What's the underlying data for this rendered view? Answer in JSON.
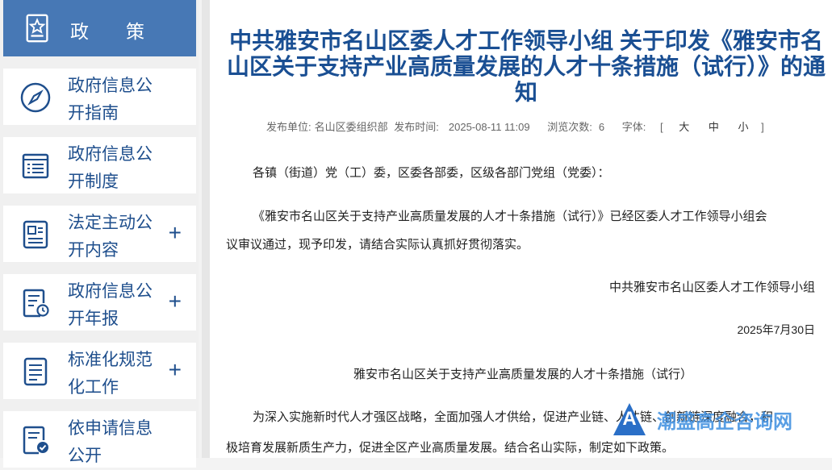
{
  "sidebar": {
    "header": {
      "label": "政策",
      "icon": "star-document-icon"
    },
    "items": [
      {
        "label": "政府信息公开指南",
        "icon": "compass-icon",
        "plus": ""
      },
      {
        "label": "政府信息公开制度",
        "icon": "list-document-icon",
        "plus": ""
      },
      {
        "label": "法定主动公开内容",
        "icon": "id-card-icon",
        "plus": "+"
      },
      {
        "label": "政府信息公开年报",
        "icon": "report-clock-icon",
        "plus": "+"
      },
      {
        "label": "标准化规范化工作",
        "icon": "document-lines-icon",
        "plus": "+"
      },
      {
        "label": "依申请信息公开",
        "icon": "document-check-icon",
        "plus": ""
      }
    ]
  },
  "article": {
    "title": "中共雅安市名山区委人才工作领导小组 关于印发《雅安市名山区关于支持产业高质量发展的人才十条措施（试行）》的通知",
    "meta": {
      "publisher_label": "发布单位:",
      "publisher": "名山区委组织部",
      "time_label": "发布时间:",
      "time": "2025-08-11 11:09",
      "views_label": "浏览次数:",
      "views": "6",
      "font_label": "字体:",
      "font_open": "[",
      "font_large": "大",
      "font_medium": "中",
      "font_small": "小",
      "font_close": "]"
    },
    "salutation": "各镇（街道）党（工）委，区委各部委，区级各部门党组（党委）：",
    "para1_line1": "《雅安市名山区关于支持产业高质量发展的人才十条措施（试行）》已经区委人才工作领导小组会",
    "para1_line2": "议审议通过，现予印发，请结合实际认真抓好贯彻落实。",
    "signature": "中共雅安市名山区委人才工作领导小组",
    "date": "2025年7月30日",
    "subtitle": "雅安市名山区关于支持产业高质量发展的人才十条措施（试行）",
    "para2_line1": "为深入实施新时代人才强区战略，全面加强人才供给，促进产业链、人才链、创新链深度融合，积",
    "para2_line2": "极培育发展新质生产力，促进全区产业高质量发展。结合名山实际，制定如下政策。"
  },
  "watermark": {
    "logo_letter": "A",
    "text": "潮盛高企咨询网"
  },
  "colors": {
    "accent": "#4778b5",
    "title": "#1a4f93",
    "nav_text": "#1f4f8d"
  }
}
